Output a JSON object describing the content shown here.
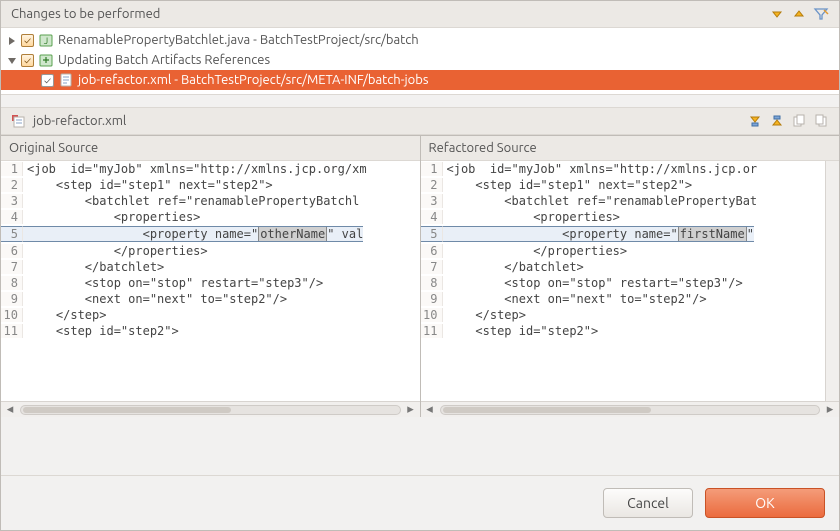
{
  "header": {
    "title": "Changes to be performed"
  },
  "tree": {
    "node1": {
      "label": "RenamablePropertyBatchlet.java - BatchTestProject/src/batch"
    },
    "node2": {
      "label": "Updating Batch Artifacts References"
    },
    "node3": {
      "label": "job-refactor.xml - BatchTestProject/src/META-INF/batch-jobs"
    }
  },
  "editor": {
    "filename": "job-refactor.xml"
  },
  "panes": {
    "left_title": "Original Source",
    "right_title": "Refactored Source"
  },
  "code": {
    "left": {
      "l1": "<job  id=\"myJob\" xmlns=\"http://xmlns.jcp.org/xm",
      "l2": "    <step id=\"step1\" next=\"step2\">",
      "l3": "        <batchlet ref=\"renamablePropertyBatchl",
      "l4": "            <properties>",
      "l5a": "                <property name=\"",
      "l5h": "otherName",
      "l5b": "\" val",
      "l6": "            </properties>",
      "l7": "        </batchlet>",
      "l8": "        <stop on=\"stop\" restart=\"step3\"/>",
      "l9": "        <next on=\"next\" to=\"step2\"/>",
      "l10": "    </step>",
      "l11": "    <step id=\"step2\">"
    },
    "right": {
      "l1": "<job  id=\"myJob\" xmlns=\"http://xmlns.jcp.or",
      "l2": "    <step id=\"step1\" next=\"step2\">",
      "l3": "        <batchlet ref=\"renamablePropertyBat",
      "l4": "            <properties>",
      "l5a": "                <property name=\"",
      "l5h": "firstName",
      "l5b": "\"",
      "l6": "            </properties>",
      "l7": "        </batchlet>",
      "l8": "        <stop on=\"stop\" restart=\"step3\"/>",
      "l9": "        <next on=\"next\" to=\"step2\"/>",
      "l10": "    </step>",
      "l11": "    <step id=\"step2\">"
    },
    "ln": {
      "n1": "1",
      "n2": "2",
      "n3": "3",
      "n4": "4",
      "n5": "5",
      "n6": "6",
      "n7": "7",
      "n8": "8",
      "n9": "9",
      "n10": "10",
      "n11": "11"
    }
  },
  "buttons": {
    "cancel": "Cancel",
    "ok": "OK"
  }
}
